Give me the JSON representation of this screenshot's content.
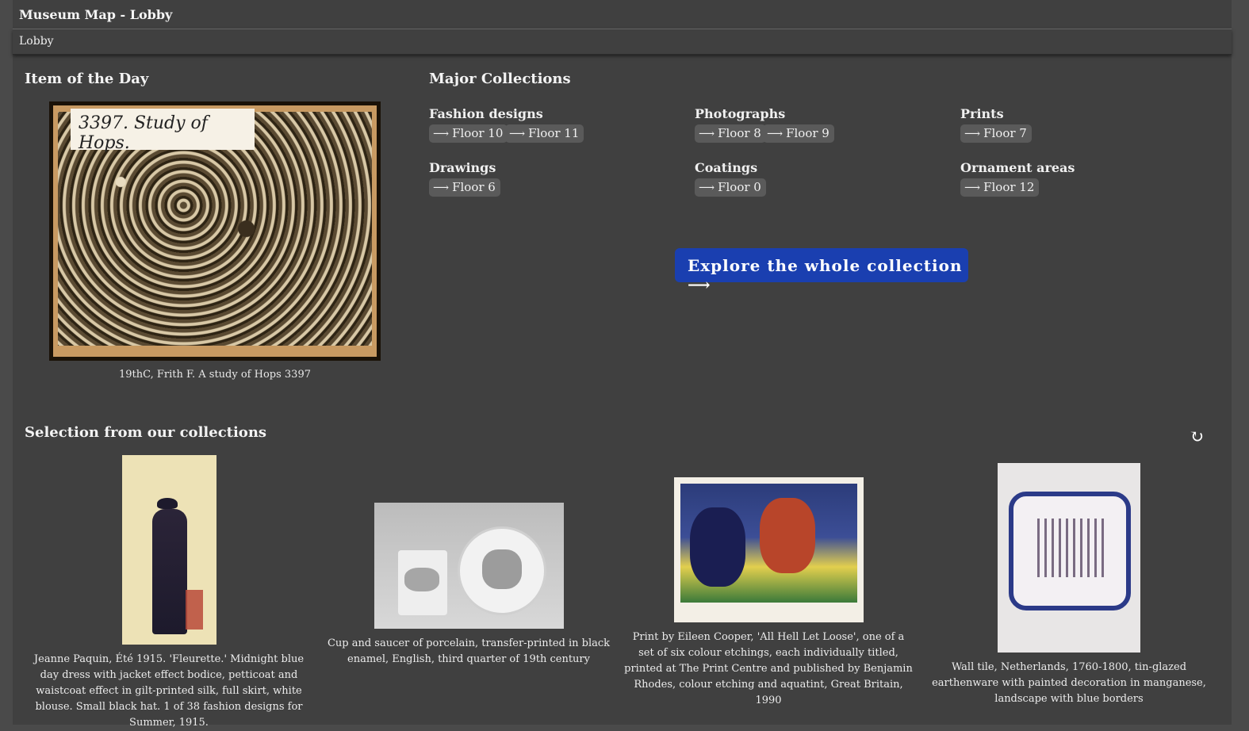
{
  "window": {
    "title": "Museum Map - Lobby"
  },
  "breadcrumb": {
    "current": "Lobby"
  },
  "item_of_the_day": {
    "heading": "Item of the Day",
    "image_label": "3397. Study of Hops.",
    "caption": "19thC, Frith F. A study of Hops 3397"
  },
  "major_collections": {
    "heading": "Major Collections",
    "arrow": "⟶",
    "groups": [
      {
        "title": "Fashion designs",
        "floors": [
          "Floor 10",
          "Floor 11"
        ]
      },
      {
        "title": "Photographs",
        "floors": [
          "Floor 8",
          "Floor 9"
        ]
      },
      {
        "title": "Prints",
        "floors": [
          "Floor 7"
        ]
      },
      {
        "title": "Drawings",
        "floors": [
          "Floor 6"
        ]
      },
      {
        "title": "Coatings",
        "floors": [
          "Floor 0"
        ]
      },
      {
        "title": "Ornament areas",
        "floors": [
          "Floor 12"
        ]
      }
    ],
    "explore_label": "Explore the whole collection ⟶"
  },
  "selection": {
    "heading": "Selection from our collections",
    "refresh_icon": "↻",
    "items": [
      {
        "caption": "Jeanne Paquin, Été 1915. 'Fleurette.' Midnight blue day dress with jacket effect bodice, petticoat and waistcoat effect in gilt-printed silk, full skirt, white blouse. Small black hat. 1 of 38 fashion designs for Summer, 1915."
      },
      {
        "caption": "Cup and saucer of porcelain, transfer-printed in black enamel, English, third quarter of 19th century"
      },
      {
        "caption": "Print by Eileen Cooper, 'All Hell Let Loose', one of a set of six colour etchings, each individually titled, printed at The Print Centre and published by Benjamin Rhodes, colour etching and aquatint, Great Britain, 1990"
      },
      {
        "caption": "Wall tile, Netherlands, 1760-1800, tin-glazed earthenware with painted decoration in manganese, landscape with blue borders"
      }
    ]
  },
  "colors": {
    "background": "#404040",
    "explore_button": "#1a3fb0",
    "chip": "#5a5a5a"
  }
}
